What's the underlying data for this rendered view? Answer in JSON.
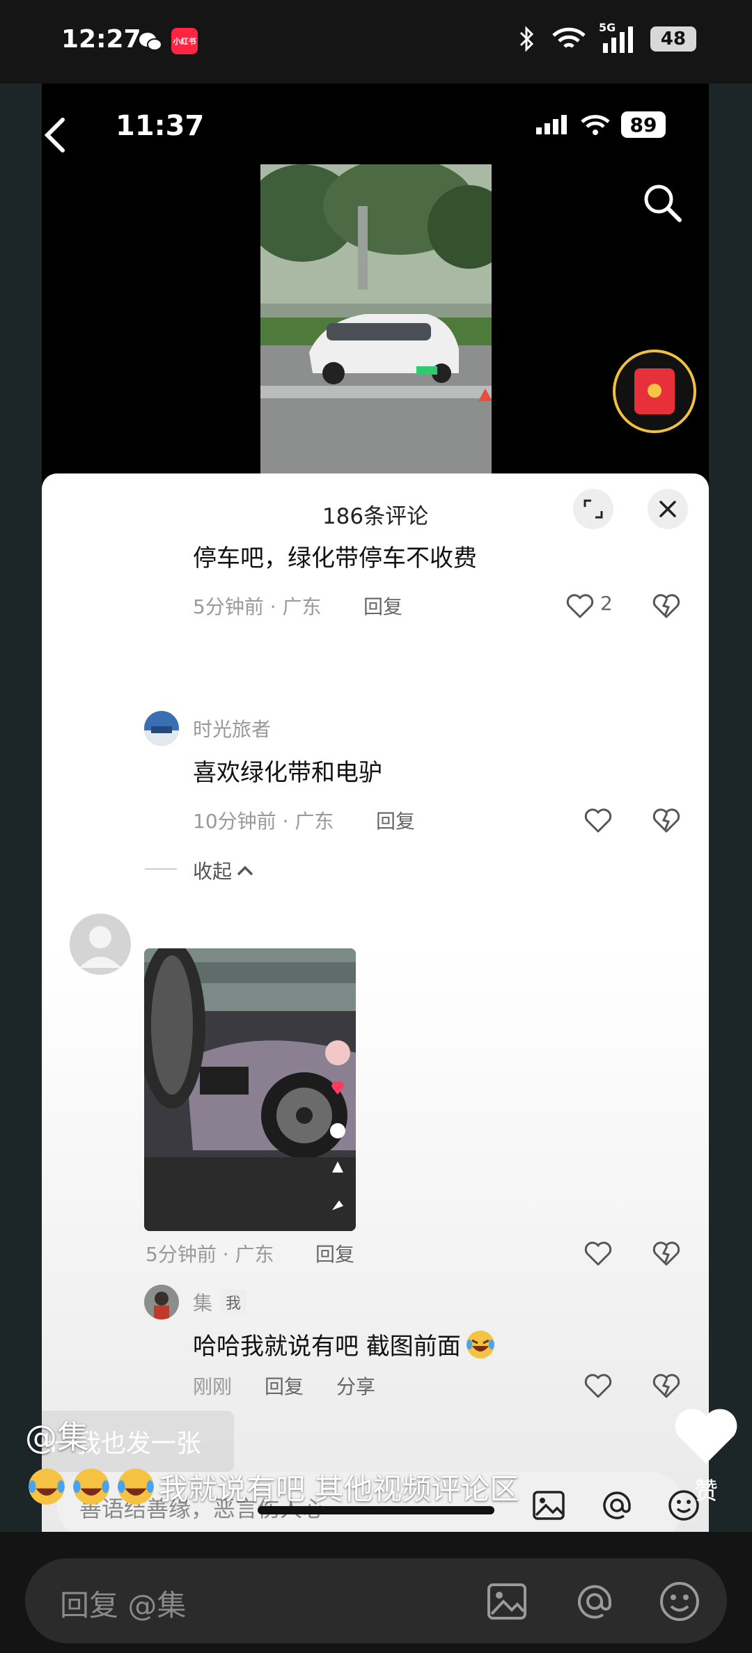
{
  "outer_status": {
    "time": "12:27",
    "xhs_label": "小红书",
    "network": "5G",
    "battery": "48"
  },
  "inner_status": {
    "time": "11:37",
    "battery": "89"
  },
  "panel": {
    "title": "186条评论"
  },
  "comments": [
    {
      "text": "停车吧，绿化带停车不收费",
      "meta": "5分钟前 · 广东",
      "reply": "回复",
      "likes": "2"
    },
    {
      "name": "时光旅者",
      "text": "喜欢绿化带和电驴",
      "meta": "10分钟前 · 广东",
      "reply": "回复"
    },
    {
      "collapse": "收起"
    },
    {
      "meta": "5分钟前 · 广东",
      "reply": "回复"
    },
    {
      "name": "集",
      "badge": "我",
      "text": "哈哈我就说有吧 截图前面",
      "meta": "刚刚",
      "reply": "回复",
      "share": "分享"
    }
  ],
  "panel_bottom": {
    "post_label": "我也发一张",
    "input_placeholder": "善语结善缘，恶言伤人心"
  },
  "overlay": {
    "username": "@集",
    "caption": "我就说有吧 其他视频评论区",
    "like_label": "赞"
  },
  "bottom_bar": {
    "placeholder": "回复 @集"
  },
  "colors": {
    "accent_red": "#ff2442",
    "gold_ring": "#f0c040"
  }
}
